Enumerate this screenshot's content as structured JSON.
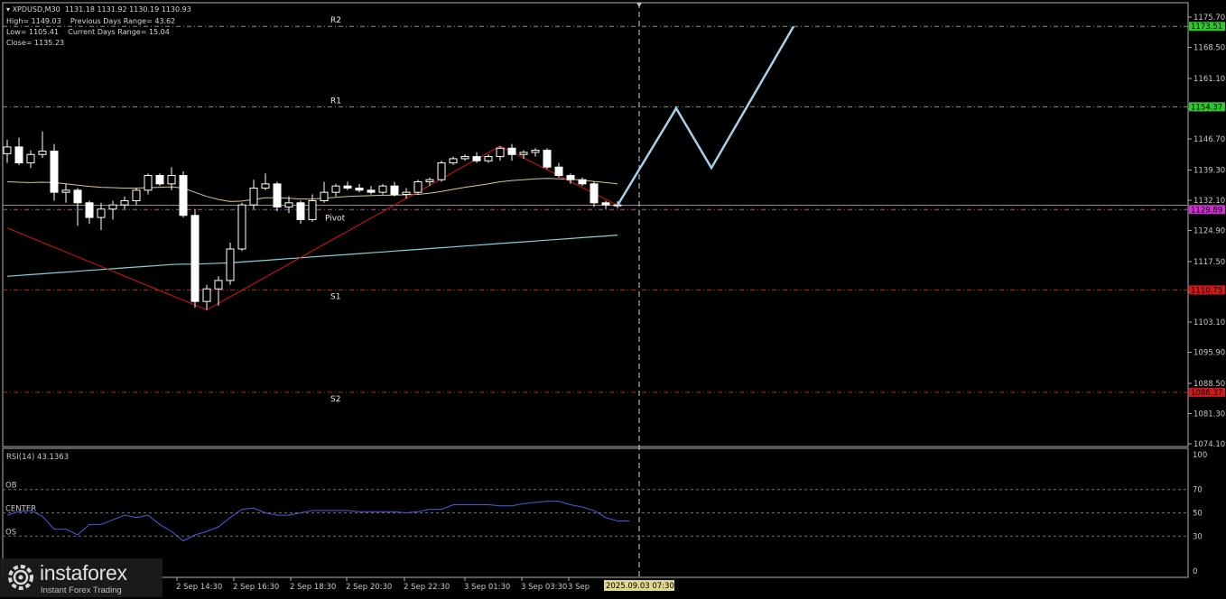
{
  "header": {
    "symbol_line": "XPDUSD,M30  1131.18 1131.92 1130.19 1130.93",
    "line2": "High= 1149.03    Previous Days Range= 43.62",
    "line3": "Low= 1105.41    Current Days Range= 15.04",
    "line4": "Close= 1135.23"
  },
  "colors": {
    "background": "#000000",
    "candle_up": "#ffffff",
    "candle_down": "#ffffff",
    "wick": "#ffffff",
    "ma_fast": "#d6c98a",
    "ma_slow": "#7fd4d4",
    "zigzag": "#e01010",
    "forecast": "#a8cfe8",
    "resistance_line": "#7a9a7a",
    "support_line": "#c02020",
    "pivot_line": "#c040c0",
    "rsi": "#4060e0",
    "grid_text": "#c8c8c8"
  },
  "chart_data": {
    "type": "candlestick",
    "symbol": "XPDUSD",
    "timeframe": "M30",
    "ylim": [
      1074.1,
      1178.5
    ],
    "y_ticks": [
      1175.7,
      1168.5,
      1161.1,
      1153.9,
      1146.7,
      1139.3,
      1132.1,
      1124.9,
      1117.5,
      1110.3,
      1103.1,
      1095.9,
      1088.5,
      1081.3,
      1074.1
    ],
    "x_labels": [
      "2 Sep 14:30",
      "2 Sep 16:30",
      "2 Sep 18:30",
      "2 Sep 20:30",
      "2 Sep 22:30",
      "3 Sep 01:30",
      "3 Sep 03:30",
      "3 Sep"
    ],
    "current_time_label": "2025.09.03 07:30",
    "candles": [
      [
        1143.2,
        1146.5,
        1141.0,
        1144.8
      ],
      [
        1144.8,
        1147.0,
        1140.5,
        1141.0
      ],
      [
        1141.0,
        1144.0,
        1139.8,
        1143.0
      ],
      [
        1143.0,
        1148.5,
        1142.2,
        1143.8
      ],
      [
        1143.8,
        1145.5,
        1132.0,
        1134.0
      ],
      [
        1134.0,
        1136.0,
        1131.5,
        1134.5
      ],
      [
        1134.5,
        1135.0,
        1126.0,
        1131.5
      ],
      [
        1131.5,
        1132.0,
        1126.5,
        1128.0
      ],
      [
        1128.0,
        1131.5,
        1125.0,
        1130.0
      ],
      [
        1130.0,
        1132.0,
        1127.5,
        1131.0
      ],
      [
        1131.0,
        1133.0,
        1130.0,
        1132.0
      ],
      [
        1132.0,
        1135.0,
        1131.0,
        1134.5
      ],
      [
        1134.5,
        1138.5,
        1133.5,
        1138.0
      ],
      [
        1138.0,
        1138.5,
        1135.5,
        1136.0
      ],
      [
        1136.0,
        1140.0,
        1134.5,
        1138.0
      ],
      [
        1138.0,
        1139.0,
        1128.0,
        1128.5
      ],
      [
        1128.5,
        1130.0,
        1106.5,
        1108.0
      ],
      [
        1108.0,
        1112.0,
        1106.0,
        1111.0
      ],
      [
        1111.0,
        1114.0,
        1107.0,
        1113.0
      ],
      [
        1113.0,
        1122.0,
        1112.0,
        1120.5
      ],
      [
        1120.5,
        1131.5,
        1120.0,
        1131.0
      ],
      [
        1131.0,
        1137.0,
        1130.0,
        1135.0
      ],
      [
        1135.0,
        1138.5,
        1134.5,
        1136.0
      ],
      [
        1136.0,
        1136.5,
        1129.5,
        1130.5
      ],
      [
        1130.5,
        1133.0,
        1129.0,
        1131.5
      ],
      [
        1131.5,
        1132.0,
        1126.5,
        1127.5
      ],
      [
        1127.5,
        1133.5,
        1127.0,
        1132.0
      ],
      [
        1132.0,
        1136.5,
        1131.5,
        1134.0
      ],
      [
        1134.0,
        1136.0,
        1133.0,
        1135.5
      ],
      [
        1135.5,
        1136.5,
        1134.5,
        1135.0
      ],
      [
        1135.0,
        1136.0,
        1134.0,
        1134.5
      ],
      [
        1134.5,
        1135.5,
        1133.5,
        1134.0
      ],
      [
        1134.0,
        1136.0,
        1133.5,
        1135.5
      ],
      [
        1135.5,
        1136.5,
        1133.0,
        1133.5
      ],
      [
        1133.5,
        1135.0,
        1132.5,
        1134.0
      ],
      [
        1134.0,
        1137.0,
        1133.5,
        1136.5
      ],
      [
        1136.5,
        1137.5,
        1135.5,
        1137.0
      ],
      [
        1137.0,
        1141.5,
        1136.5,
        1141.0
      ],
      [
        1141.0,
        1142.5,
        1140.5,
        1142.0
      ],
      [
        1142.0,
        1143.0,
        1141.5,
        1142.5
      ],
      [
        1142.5,
        1143.5,
        1141.0,
        1141.5
      ],
      [
        1141.5,
        1143.0,
        1141.0,
        1142.5
      ],
      [
        1142.5,
        1145.0,
        1141.5,
        1144.5
      ],
      [
        1144.5,
        1145.5,
        1141.5,
        1143.0
      ],
      [
        1143.0,
        1144.0,
        1142.0,
        1143.5
      ],
      [
        1143.5,
        1144.5,
        1142.5,
        1144.0
      ],
      [
        1144.0,
        1144.5,
        1139.5,
        1140.0
      ],
      [
        1140.0,
        1141.0,
        1137.5,
        1138.0
      ],
      [
        1138.0,
        1138.5,
        1136.0,
        1137.0
      ],
      [
        1137.0,
        1137.5,
        1135.5,
        1136.0
      ],
      [
        1136.0,
        1136.5,
        1130.5,
        1131.5
      ],
      [
        1131.5,
        1132.0,
        1130.0,
        1131.0
      ],
      [
        1131.0,
        1131.9,
        1130.2,
        1130.9
      ]
    ],
    "ma_fast": [
      1136.5,
      1136.4,
      1136.3,
      1136.4,
      1136.3,
      1136.0,
      1135.7,
      1135.4,
      1135.2,
      1135.1,
      1135.0,
      1135.0,
      1135.1,
      1135.2,
      1135.3,
      1135.0,
      1134.0,
      1133.0,
      1132.3,
      1131.8,
      1131.9,
      1132.3,
      1132.7,
      1132.7,
      1132.6,
      1132.4,
      1132.4,
      1132.6,
      1132.8,
      1133.0,
      1133.1,
      1133.2,
      1133.3,
      1133.3,
      1133.4,
      1133.5,
      1133.8,
      1134.2,
      1134.7,
      1135.2,
      1135.6,
      1136.0,
      1136.5,
      1136.8,
      1137.0,
      1137.2,
      1137.3,
      1137.2,
      1137.1,
      1136.9,
      1136.6,
      1136.3,
      1136.0
    ],
    "ma_slow": [
      1114.0,
      1114.2,
      1114.4,
      1114.6,
      1114.8,
      1115.0,
      1115.2,
      1115.4,
      1115.6,
      1115.8,
      1116.0,
      1116.2,
      1116.4,
      1116.6,
      1116.8,
      1116.9,
      1116.9,
      1117.0,
      1117.1,
      1117.2,
      1117.4,
      1117.6,
      1117.8,
      1118.0,
      1118.2,
      1118.4,
      1118.6,
      1118.8,
      1119.0,
      1119.2,
      1119.4,
      1119.6,
      1119.8,
      1120.0,
      1120.2,
      1120.4,
      1120.6,
      1120.8,
      1121.0,
      1121.2,
      1121.4,
      1121.6,
      1121.8,
      1122.0,
      1122.2,
      1122.4,
      1122.6,
      1122.8,
      1123.0,
      1123.2,
      1123.4,
      1123.6,
      1123.8
    ],
    "zigzag": [
      [
        0,
        1125.5
      ],
      [
        17,
        1106.0
      ],
      [
        42,
        1145.0
      ],
      [
        52,
        1130.9
      ]
    ],
    "forecast": [
      [
        52,
        1130.9
      ],
      [
        57,
        1154.0
      ],
      [
        60,
        1139.8
      ],
      [
        67,
        1173.5
      ]
    ],
    "levels": [
      {
        "label": "R2",
        "price": 1173.51,
        "role": "resistance"
      },
      {
        "label": "R1",
        "price": 1154.37,
        "role": "resistance"
      },
      {
        "label": "Pivot",
        "price": 1129.89,
        "role": "pivot"
      },
      {
        "label": "S1",
        "price": 1110.75,
        "role": "support"
      },
      {
        "label": "S2",
        "price": 1086.37,
        "role": "support"
      }
    ],
    "level_price_labels": [
      "1173.51",
      "1154.37",
      "1129.89",
      "1110.75",
      "1086.37"
    ],
    "current_price": 1130.93,
    "rsi": {
      "label": "RSI(14) 43.1363",
      "ylim": [
        0,
        100
      ],
      "y_ticks": [
        100,
        70,
        50,
        30,
        0
      ],
      "zone_labels": [
        "OB",
        "CENTER",
        "OS"
      ],
      "values": [
        48,
        51,
        52,
        47,
        36,
        36,
        31,
        40,
        40,
        44,
        48,
        46,
        48,
        40,
        34,
        26,
        31,
        34,
        38,
        46,
        53,
        54,
        50,
        48,
        48,
        50,
        52,
        52,
        52,
        52,
        51,
        51,
        51,
        51,
        50,
        51,
        53,
        53,
        57,
        57,
        57,
        57,
        56,
        56,
        58,
        59,
        60,
        60,
        57,
        55,
        52,
        46,
        43,
        43
      ]
    }
  },
  "logo": {
    "name": "instaforex",
    "tagline": "Instant Forex Trading"
  }
}
